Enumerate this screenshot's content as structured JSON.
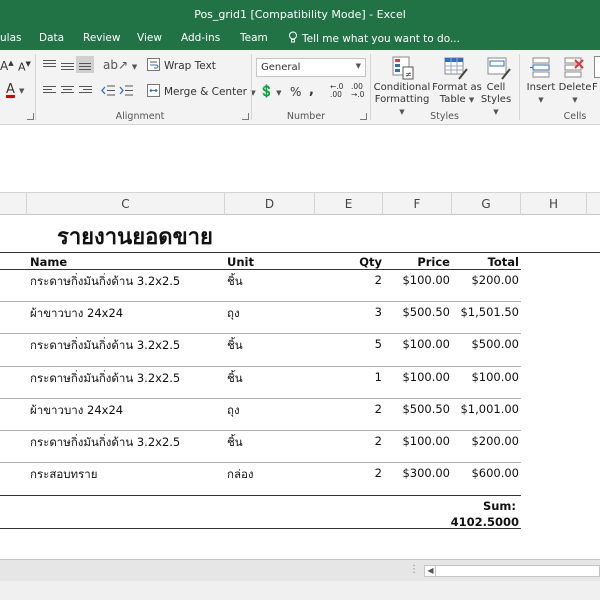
{
  "window": {
    "title": "Pos_grid1  [Compatibility Mode] - Excel"
  },
  "tabs": [
    "ulas",
    "Data",
    "Review",
    "View",
    "Add-ins",
    "Team"
  ],
  "tell_me": "Tell me what you want to do...",
  "ribbon": {
    "font_a_large": "A",
    "font_a_small": "A",
    "wrap_text": "Wrap Text",
    "merge_center": "Merge & Center",
    "number_format": "General",
    "percent": "%",
    "comma": ",",
    "inc_decimal": "←.0 .00",
    "dec_decimal": ".00 →.0",
    "alignment_label": "Alignment",
    "number_label": "Number",
    "styles_label": "Styles",
    "cells_label": "Cells",
    "conditional_formatting": [
      "Conditional",
      "Formatting"
    ],
    "format_as_table": [
      "Format as",
      "Table"
    ],
    "cell_styles": [
      "Cell",
      "Styles"
    ],
    "insert": "Insert",
    "delete": "Delete",
    "format_cut": "F"
  },
  "columns": [
    {
      "label": "C"
    },
    {
      "label": "D"
    },
    {
      "label": "E"
    },
    {
      "label": "F"
    },
    {
      "label": "G"
    },
    {
      "label": "H"
    }
  ],
  "sheet": {
    "title": "รายงานยอดขาย",
    "headers": {
      "name": "Name",
      "unit": "Unit",
      "qty": "Qty",
      "price": "Price",
      "total": "Total"
    },
    "rows": [
      {
        "name": "กระดาษกิ่งมันกิ่งด้าน 3.2x2.5",
        "unit": "ชิ้น",
        "qty": "2",
        "price": "$100.00",
        "total": "$200.00"
      },
      {
        "name": "ผ้าขาวบาง 24x24",
        "unit": "ถุง",
        "qty": "3",
        "price": "$500.50",
        "total": "$1,501.50"
      },
      {
        "name": "กระดาษกิ่งมันกิ่งด้าน 3.2x2.5",
        "unit": "ชิ้น",
        "qty": "5",
        "price": "$100.00",
        "total": "$500.00"
      },
      {
        "name": "กระดาษกิ่งมันกิ่งด้าน 3.2x2.5",
        "unit": "ชิ้น",
        "qty": "1",
        "price": "$100.00",
        "total": "$100.00"
      },
      {
        "name": "ผ้าขาวบาง 24x24",
        "unit": "ถุง",
        "qty": "2",
        "price": "$500.50",
        "total": "$1,001.00"
      },
      {
        "name": "กระดาษกิ่งมันกิ่งด้าน 3.2x2.5",
        "unit": "ชิ้น",
        "qty": "2",
        "price": "$100.00",
        "total": "$200.00"
      },
      {
        "name": "กระสอบทราย",
        "unit": "กล่อง",
        "qty": "2",
        "price": "$300.00",
        "total": "$600.00"
      }
    ],
    "sum_label": "Sum:",
    "sum_value": "4102.5000"
  },
  "colors": {
    "excel_green": "#217346",
    "ribbon_bg": "#f3f3f3"
  }
}
